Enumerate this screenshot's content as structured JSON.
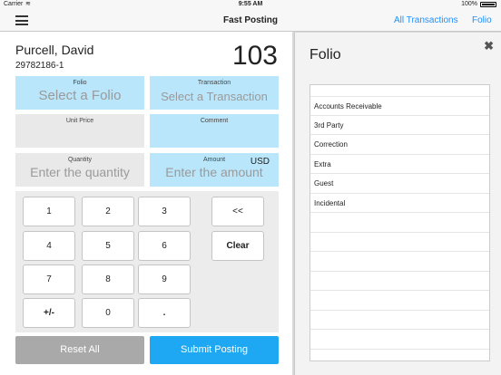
{
  "status": {
    "carrier": "Carrier",
    "time": "9:55 AM",
    "battery": "100%"
  },
  "nav": {
    "title": "Fast Posting",
    "all_transactions": "All Transactions",
    "folio": "Folio"
  },
  "guest": {
    "name": "Purcell, David",
    "id": "29782186-1",
    "room": "103"
  },
  "fields": {
    "folio": {
      "label": "Folio",
      "placeholder": "Select a Folio"
    },
    "transaction": {
      "label": "Transaction",
      "placeholder": "Select a Transaction"
    },
    "unit_price": {
      "label": "Unit Price",
      "value": ""
    },
    "comment": {
      "label": "Comment",
      "value": ""
    },
    "quantity": {
      "label": "Quantity",
      "placeholder": "Enter the quantity"
    },
    "amount": {
      "label": "Amount",
      "placeholder": "Enter the amount",
      "currency": "USD"
    }
  },
  "keypad": {
    "keys": [
      "1",
      "2",
      "3",
      "4",
      "5",
      "6",
      "7",
      "8",
      "9",
      "+/-",
      "0",
      "."
    ],
    "backspace": "<<",
    "clear": "Clear"
  },
  "buttons": {
    "reset": "Reset All",
    "submit": "Submit Posting"
  },
  "folio_panel": {
    "title": "Folio",
    "close_icon": "close-icon",
    "items": [
      "Accounts Receivable",
      "3rd Party",
      "Correction",
      "Extra",
      "Guest",
      "Incidental"
    ]
  },
  "colors": {
    "accent": "#1ea7f3",
    "field_blue": "#b9e6fb",
    "reset_gray": "#a9a9a9"
  }
}
